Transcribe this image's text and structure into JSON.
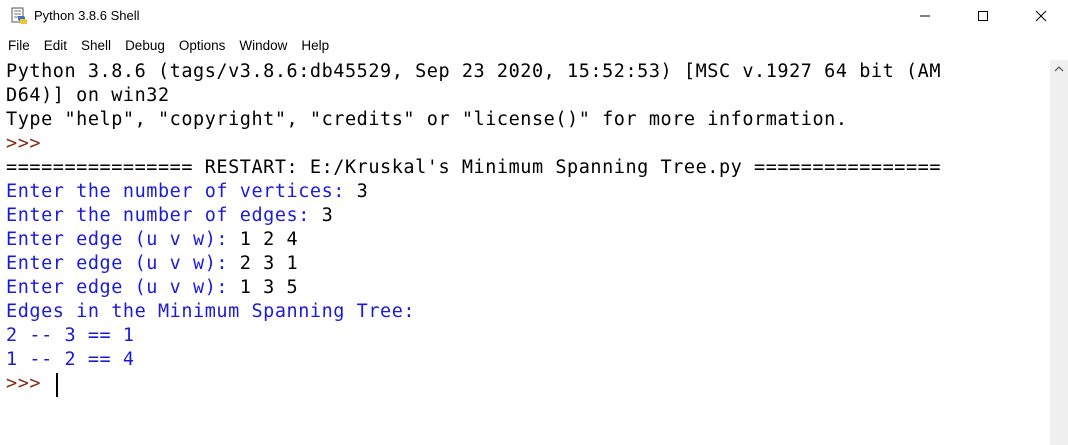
{
  "window": {
    "title": "Python 3.8.6 Shell"
  },
  "menu": [
    "File",
    "Edit",
    "Shell",
    "Debug",
    "Options",
    "Window",
    "Help"
  ],
  "shell_lines": [
    {
      "text": "Python 3.8.6 (tags/v3.8.6:db45529, Sep 23 2020, 15:52:53) [MSC v.1927 64 bit (AM",
      "kind": "output"
    },
    {
      "text": "D64)] on win32",
      "kind": "output"
    },
    {
      "text": "Type \"help\", \"copyright\", \"credits\" or \"license()\" for more information.",
      "kind": "output"
    },
    {
      "text": ">>> ",
      "kind": "prompt"
    },
    {
      "text": "================ RESTART: E:/Kruskal's Minimum Spanning Tree.py ================",
      "kind": "output"
    },
    {
      "prompt": "Enter the number of vertices: ",
      "input": "3",
      "kind": "input"
    },
    {
      "prompt": "Enter the number of edges: ",
      "input": "3",
      "kind": "input"
    },
    {
      "prompt": "Enter edge (u v w): ",
      "input": "1 2 4",
      "kind": "input"
    },
    {
      "prompt": "Enter edge (u v w): ",
      "input": "2 3 1",
      "kind": "input"
    },
    {
      "prompt": "Enter edge (u v w): ",
      "input": "1 3 5",
      "kind": "input"
    },
    {
      "text": "Edges in the Minimum Spanning Tree:",
      "kind": "stdout"
    },
    {
      "text": "2 -- 3 == 1",
      "kind": "stdout"
    },
    {
      "text": "1 -- 2 == 4",
      "kind": "stdout"
    },
    {
      "text": ">>> ",
      "kind": "prompt"
    }
  ],
  "colors": {
    "stdout": "#1a1adc",
    "output": "#000000",
    "prompt": "#8b2a16"
  }
}
